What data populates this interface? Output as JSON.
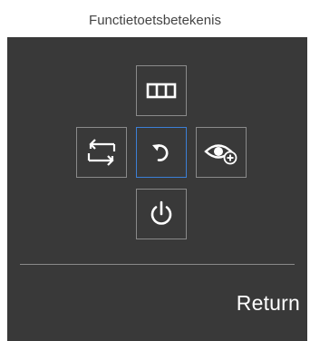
{
  "header": {
    "title": "Functietoetsbetekenis"
  },
  "keypad": {
    "keys": [
      {
        "id": "up",
        "icon": "menu-icon"
      },
      {
        "id": "left",
        "icon": "source-switch-icon"
      },
      {
        "id": "center",
        "icon": "return-icon",
        "selected": true
      },
      {
        "id": "right",
        "icon": "eye-saver-icon"
      },
      {
        "id": "down",
        "icon": "power-icon"
      }
    ]
  },
  "footer": {
    "function_label": "Return"
  },
  "colors": {
    "panel": "#393939",
    "key_border": "#8a8a8a",
    "selected_border": "#3c7fd6",
    "text": "#ffffff"
  }
}
